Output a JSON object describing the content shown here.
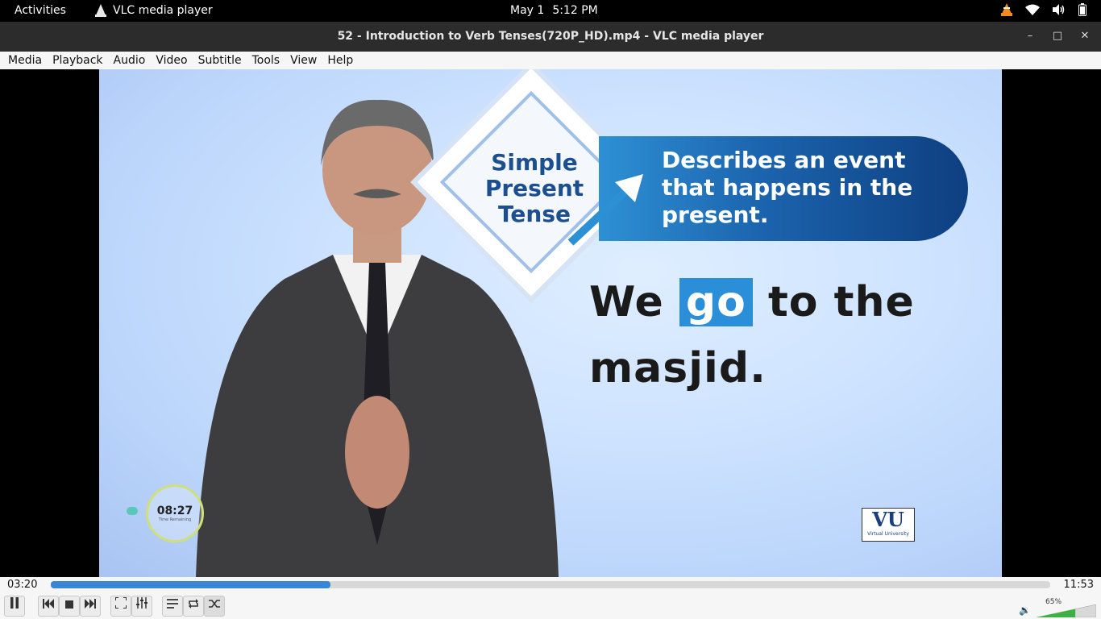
{
  "topbar": {
    "activities": "Activities",
    "app_name": "VLC media player",
    "date": "May 1",
    "time": "5:12 PM",
    "icons": [
      "vlc-tray-icon",
      "wifi-icon",
      "volume-icon",
      "battery-icon"
    ]
  },
  "window": {
    "title": "52 - Introduction to Verb Tenses(720P_HD).mp4 - VLC media player"
  },
  "menu": [
    "Media",
    "Playback",
    "Audio",
    "Video",
    "Subtitle",
    "Tools",
    "View",
    "Help"
  ],
  "video": {
    "tense_title": "Simple Present Tense",
    "definition": "Describes an event that happens in the present.",
    "example_before": "We",
    "example_highlight": "go",
    "example_after": "to the masjid.",
    "timer": "08:27",
    "timer_sub": "Time Remaining",
    "logo_mark": "VU",
    "logo_sub": "Virtual University"
  },
  "playback": {
    "elapsed": "03:20",
    "total": "11:53",
    "progress_fraction": 0.28,
    "volume": "65%",
    "volume_fraction": 0.65
  },
  "colors": {
    "accent": "#3a86d6",
    "banner": "#1b63ad",
    "highlight": "#2a8fd8"
  }
}
